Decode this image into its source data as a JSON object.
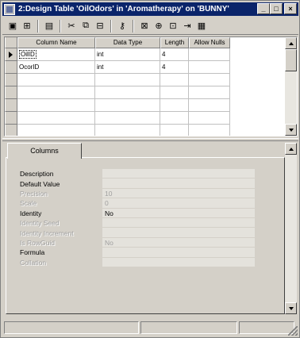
{
  "window": {
    "title": "2:Design Table 'OilOdors' in 'Aromatherapy' on  'BUNNY'",
    "controls": {
      "minimize": "_",
      "maximize": "□",
      "close": "×"
    }
  },
  "toolbar": {
    "icons": [
      "save-icon",
      "properties-icon",
      "generate-script-icon",
      "cut-icon",
      "copy-icon",
      "paste-icon",
      "set-primary-key-icon",
      "manage-relationships-icon",
      "manage-indexes-icon",
      "manage-constraints-icon",
      "manage-triggers-icon",
      "manage-checks-icon"
    ],
    "glyphs": {
      "save": "▣",
      "properties": "⊞",
      "script": "▤",
      "cut": "✂",
      "copy": "⧉",
      "paste": "⊟",
      "key": "⚷",
      "relationships": "⊠",
      "indexes": "⊕",
      "constraints": "⊡",
      "triggers": "⇥",
      "checks": "▦"
    }
  },
  "grid": {
    "columns": [
      "Column Name",
      "Data Type",
      "Length",
      "Allow Nulls"
    ],
    "rows": [
      {
        "name": "OilID",
        "type": "int",
        "length": "4",
        "allow_nulls": ""
      },
      {
        "name": "OcorID",
        "type": "int",
        "length": "4",
        "allow_nulls": ""
      }
    ]
  },
  "tabs": {
    "columns": "Columns"
  },
  "properties": [
    {
      "label": "Description",
      "value": "",
      "disabled": false
    },
    {
      "label": "Default Value",
      "value": "",
      "disabled": false
    },
    {
      "label": "Precision",
      "value": "10",
      "disabled": true
    },
    {
      "label": "Scale",
      "value": "0",
      "disabled": true
    },
    {
      "label": "Identity",
      "value": "No",
      "disabled": false
    },
    {
      "label": "Identity Seed",
      "value": "",
      "disabled": true
    },
    {
      "label": "Identity Increment",
      "value": "",
      "disabled": true
    },
    {
      "label": "Is RowGuid",
      "value": "No",
      "disabled": true
    },
    {
      "label": "Formula",
      "value": "",
      "disabled": false
    },
    {
      "label": "Collation",
      "value": "",
      "disabled": true
    }
  ],
  "status": {
    "pane1": "",
    "pane2": "",
    "pane3": ""
  }
}
